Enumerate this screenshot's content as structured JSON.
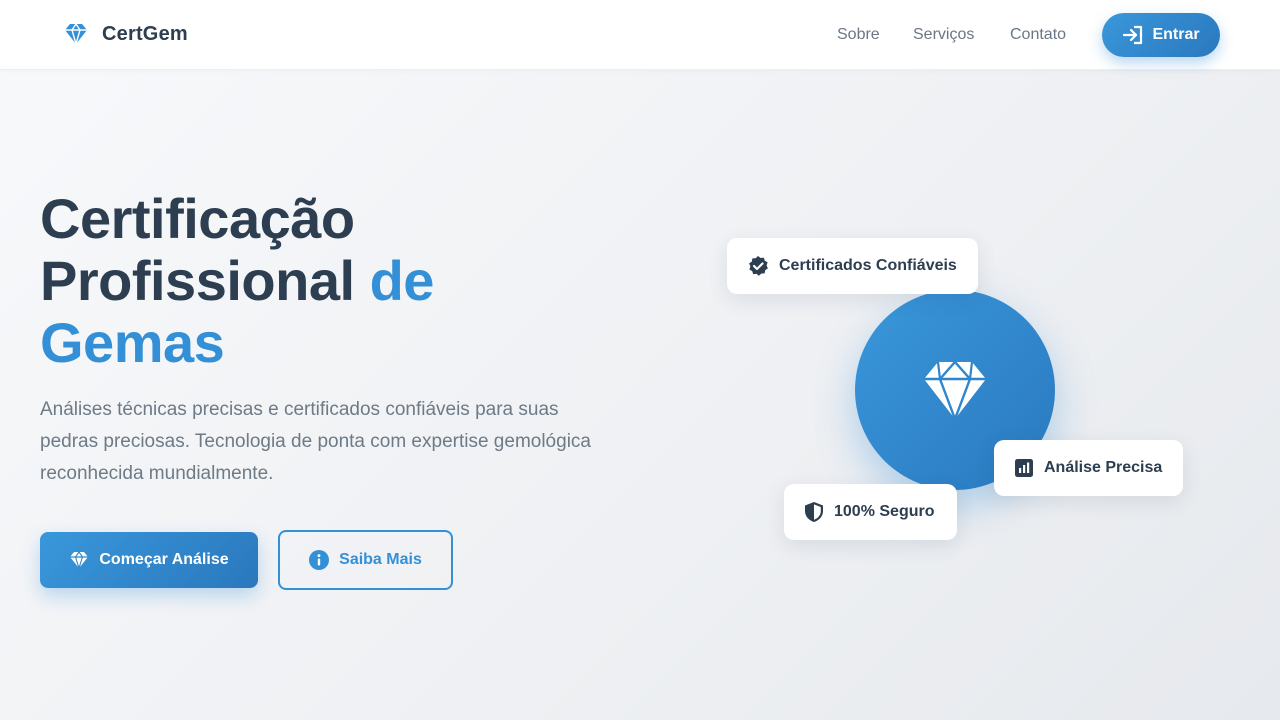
{
  "header": {
    "brand": "CertGem",
    "nav": [
      {
        "label": "Sobre",
        "icon": ""
      },
      {
        "label": "Serviços",
        "icon": ""
      },
      {
        "label": "Contato",
        "icon": ""
      }
    ],
    "login_label": "Entrar",
    "login_icon": "sign-in-icon",
    "logo_icon": "gem-icon"
  },
  "hero": {
    "title_line1": "Certificação",
    "title_line2_dark": "Profissional ",
    "title_line2_accent": "de",
    "title_line3": "Gemas",
    "description": "Análises técnicas precisas e certificados confiáveis para suas pedras preciosas. Tecnologia de ponta com expertise gemológica reconhecida mundialmente.",
    "primary_button": "Começar Análise",
    "secondary_button": "Saiba Mais"
  },
  "visual": {
    "center_icon": "gem-icon",
    "cards": [
      {
        "label": "Certificados Confiáveis",
        "icon": "certificate-check-icon"
      },
      {
        "label": "Análise Precisa",
        "icon": "chart-icon"
      },
      {
        "label": "100% Seguro",
        "icon": "shield-icon"
      }
    ]
  },
  "colors": {
    "accent": "#3490d6",
    "text_dark": "#2c3e50",
    "text_muted": "#6e7a86",
    "background": "#f3f4f6"
  }
}
